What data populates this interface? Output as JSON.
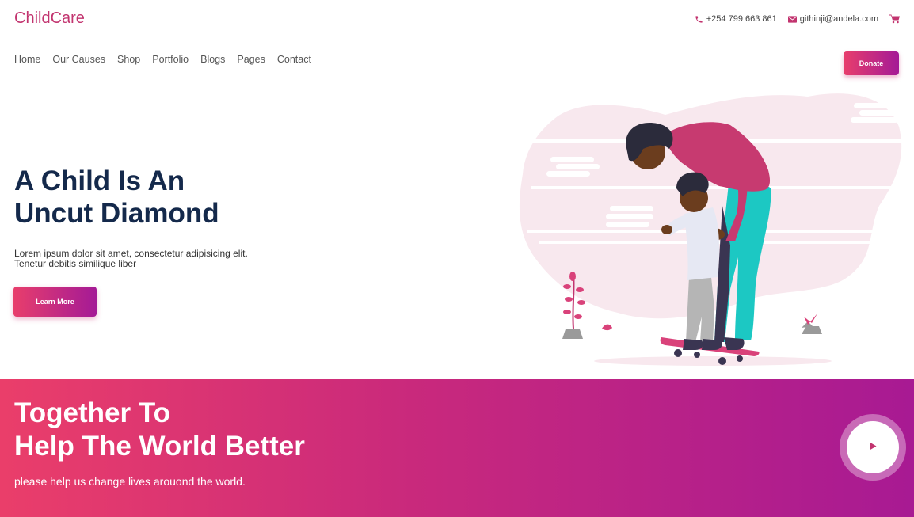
{
  "brand": {
    "name": "ChildCare"
  },
  "contact": {
    "phone": "+254 799 663 861",
    "email": "githinji@andela.com",
    "icons": [
      "phone-icon",
      "envelope-icon",
      "cart-icon"
    ]
  },
  "nav": {
    "items": [
      "Home",
      "Our Causes",
      "Shop",
      "Portfolio",
      "Blogs",
      "Pages",
      "Contact"
    ],
    "donate_label": "Donate"
  },
  "hero": {
    "title_line1": "A Child Is An",
    "title_line2": "Uncut Diamond",
    "text_line1": "Lorem ipsum dolor sit amet, consectetur adipisicing elit.",
    "text_line2": "Tenetur debitis similique liber",
    "button_label": "Learn More"
  },
  "banner": {
    "title_line1": "Together To",
    "title_line2": "Help The World Better",
    "text": "please help us change lives arouond the world.",
    "play_icon": "play-icon"
  },
  "colors": {
    "brand": "#c2346f",
    "heading": "#14294b",
    "gradient_start": "#e83e6c",
    "gradient_end": "#a41a96"
  }
}
